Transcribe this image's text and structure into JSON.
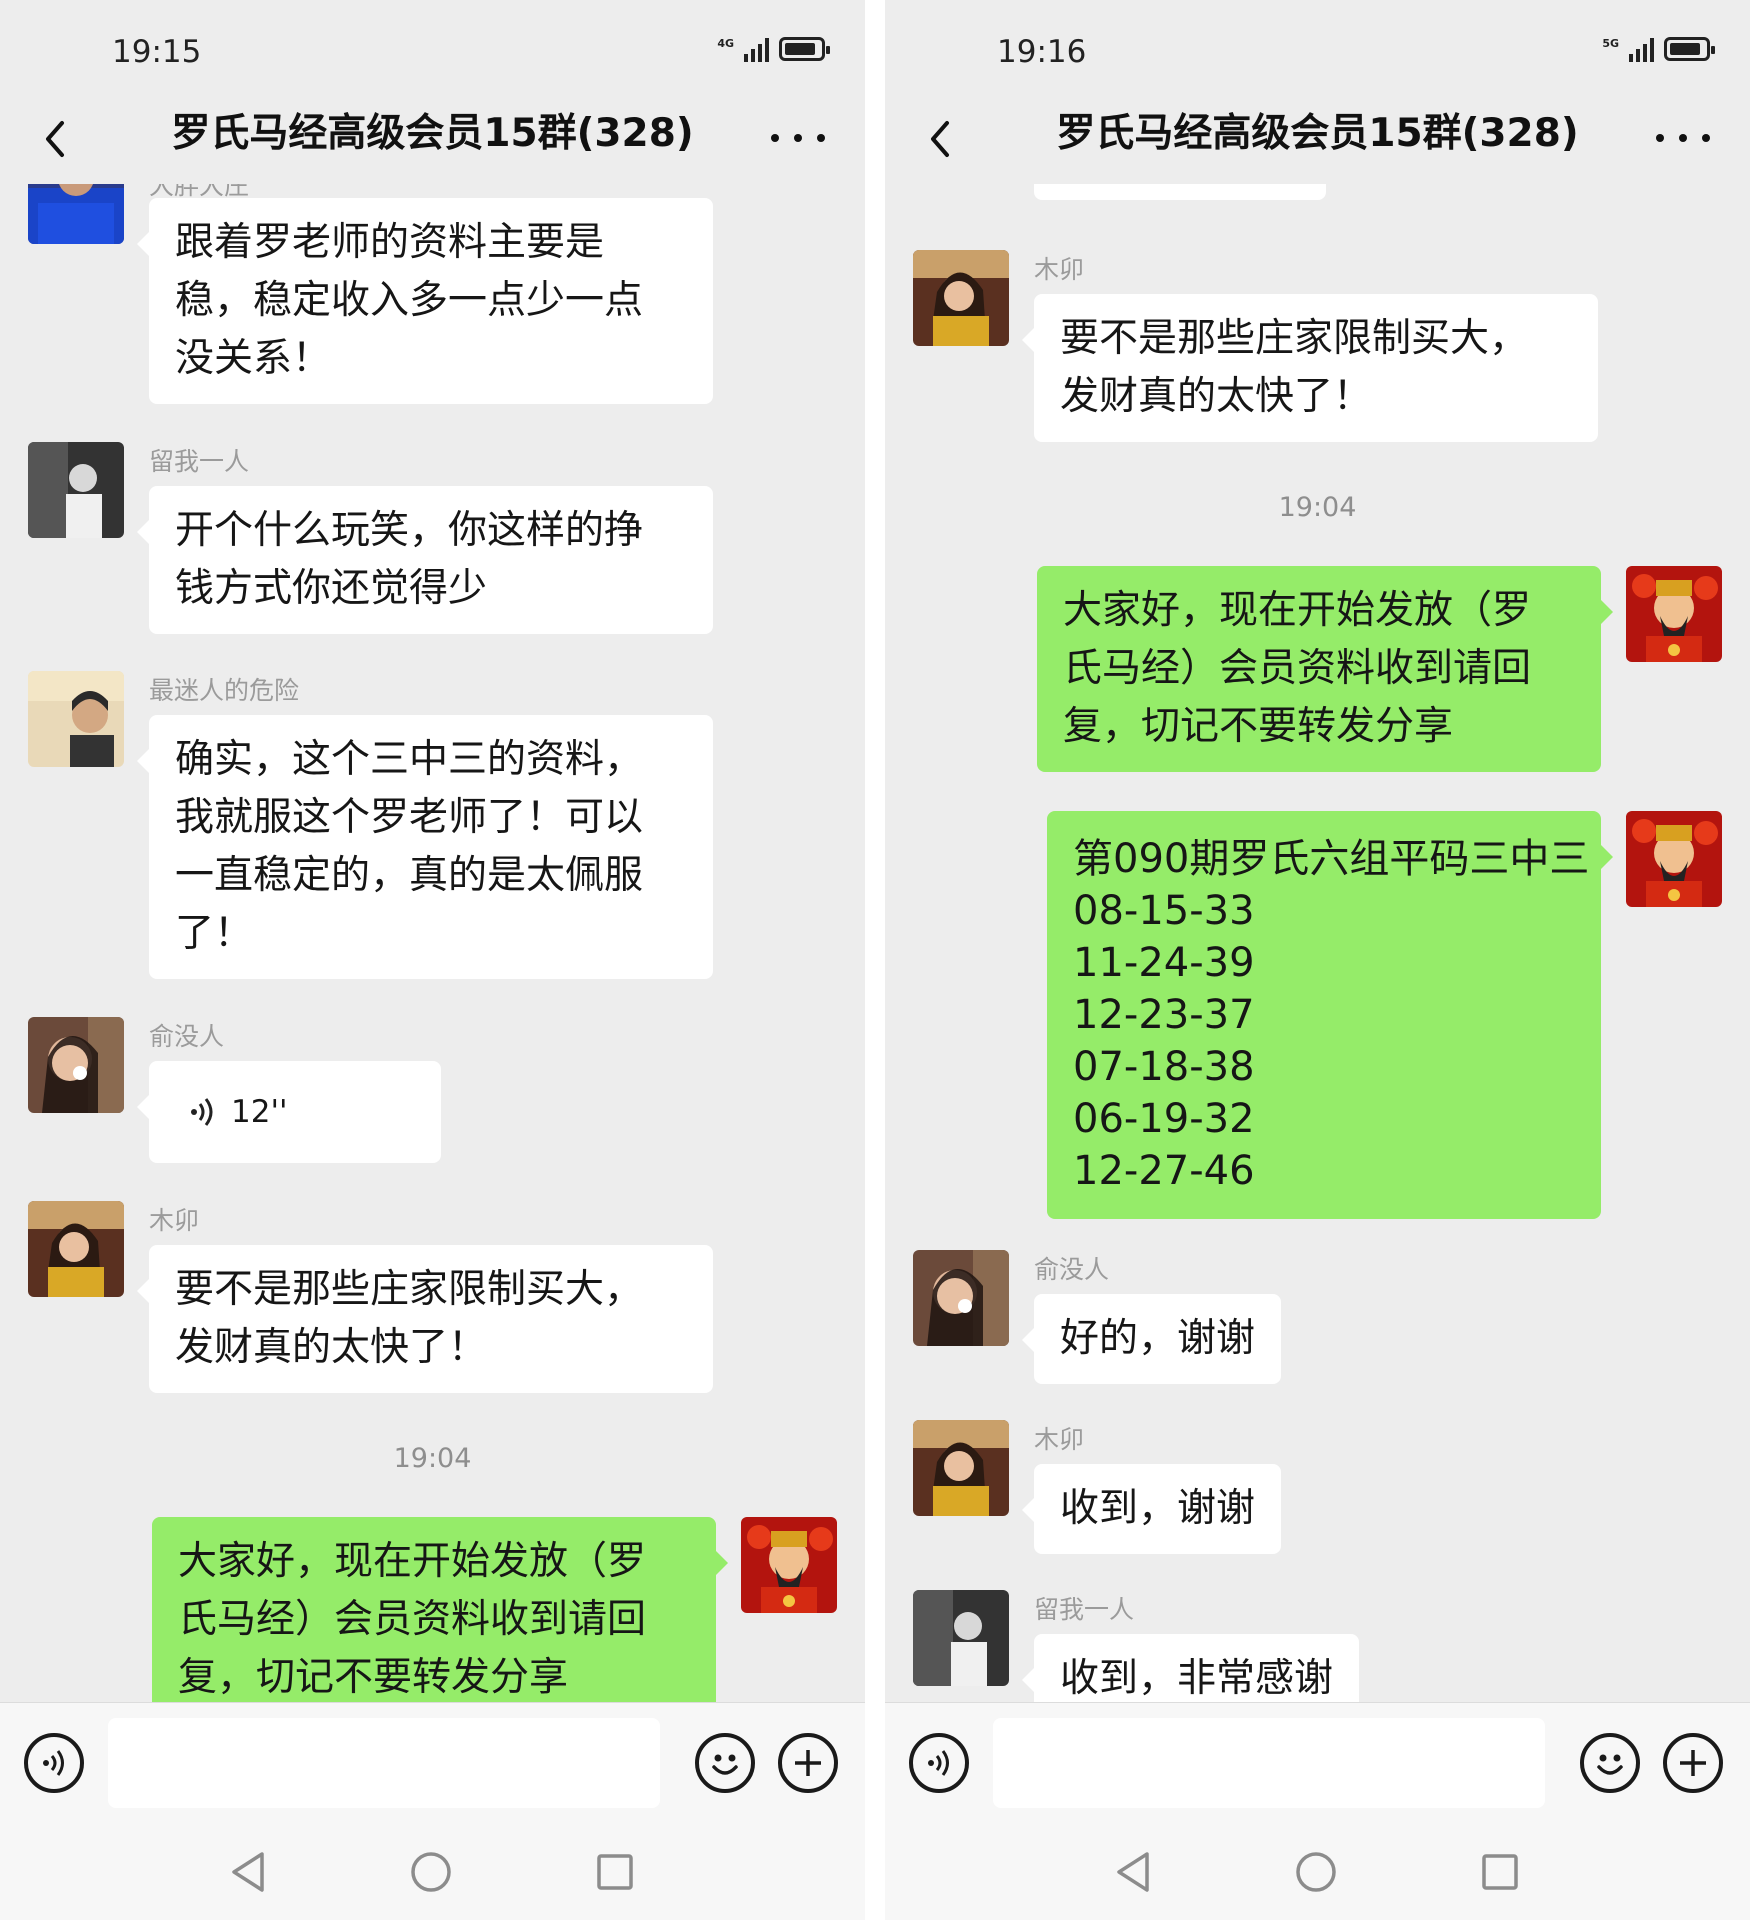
{
  "colors": {
    "background": "#ededed",
    "bubble_in": "#ffffff",
    "bubble_out": "#95ec69",
    "meta_text": "#9b9b9b"
  },
  "left": {
    "status": {
      "time": "19:15",
      "network": "4G"
    },
    "title": "罗氏马经高级会员15群(328)",
    "partial_top_name": "大胖大庄",
    "messages": [
      {
        "lines": [
          "跟着罗老师的资料主要是",
          "稳，稳定收入多一点少一点",
          "没关系！"
        ]
      },
      {
        "sender": "留我一人",
        "lines": [
          "开个什么玩笑，你这样的挣",
          "钱方式你还觉得少"
        ]
      },
      {
        "sender": "最迷人的危险",
        "lines": [
          "确实，这个三中三的资料，",
          "我就服这个罗老师了！可以",
          "一直稳定的，真的是太佩服",
          "了！"
        ]
      },
      {
        "sender": "俞没人",
        "voice": "12''"
      },
      {
        "sender": "木卯",
        "lines": [
          "要不是那些庄家限制买大，",
          "发财真的太快了！"
        ]
      },
      {
        "timestamp": "19:04"
      },
      {
        "outgoing": true,
        "lines": [
          "大家好，现在开始发放（罗",
          "氏马经）会员资料收到请回",
          "复，切记不要转发分享"
        ]
      }
    ]
  },
  "right": {
    "status": {
      "time": "19:16",
      "network": "5G"
    },
    "title": "罗氏马经高级会员15群(328)",
    "messages": [
      {
        "sender": "木卯",
        "lines": [
          "要不是那些庄家限制买大，",
          "发财真的太快了！"
        ]
      },
      {
        "timestamp": "19:04"
      },
      {
        "outgoing": true,
        "lines": [
          "大家好，现在开始发放（罗",
          "氏马经）会员资料收到请回",
          "复，切记不要转发分享"
        ]
      },
      {
        "outgoing": true,
        "lines": [
          "第090期罗氏六组平码三中三",
          "08-15-33",
          "11-24-39",
          "12-23-37",
          "07-18-38",
          "06-19-32",
          "12-27-46"
        ]
      },
      {
        "sender": "俞没人",
        "lines": [
          "好的，谢谢"
        ]
      },
      {
        "sender": "木卯",
        "lines": [
          "收到，谢谢"
        ]
      },
      {
        "sender": "留我一人",
        "lines": [
          "收到，非常感谢"
        ]
      }
    ]
  },
  "icons": [
    "back-icon",
    "more-icon",
    "voice-input-icon",
    "emoji-icon",
    "plus-icon",
    "nav-back-icon",
    "nav-home-icon",
    "nav-recents-icon",
    "voice-wave-icon"
  ]
}
